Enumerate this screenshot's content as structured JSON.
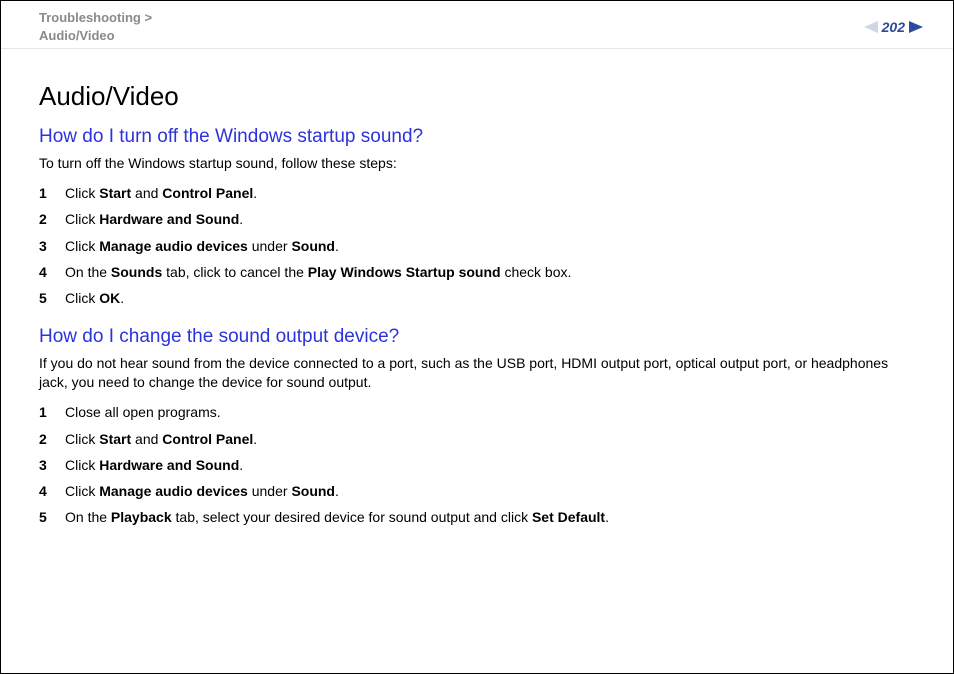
{
  "breadcrumb": {
    "parent": "Troubleshooting",
    "sep": ">",
    "current": "Audio/Video"
  },
  "page_number": "202",
  "h1": "Audio/Video",
  "section1": {
    "heading": "How do I turn off the Windows startup sound?",
    "intro": "To turn off the Windows startup sound, follow these steps:",
    "steps": [
      {
        "n": "1",
        "html": "Click <b>Start</b> and <b>Control Panel</b>."
      },
      {
        "n": "2",
        "html": "Click <b>Hardware and Sound</b>."
      },
      {
        "n": "3",
        "html": "Click <b>Manage audio devices</b> under <b>Sound</b>."
      },
      {
        "n": "4",
        "html": "On the <b>Sounds</b> tab, click to cancel the <b>Play Windows Startup sound</b> check box."
      },
      {
        "n": "5",
        "html": "Click <b>OK</b>."
      }
    ]
  },
  "section2": {
    "heading": "How do I change the sound output device?",
    "intro": "If you do not hear sound from the device connected to a port, such as the USB port, HDMI output port, optical output port, or headphones jack, you need to change the device for sound output.",
    "steps": [
      {
        "n": "1",
        "html": "Close all open programs."
      },
      {
        "n": "2",
        "html": "Click <b>Start</b> and <b>Control Panel</b>."
      },
      {
        "n": "3",
        "html": "Click <b>Hardware and Sound</b>."
      },
      {
        "n": "4",
        "html": "Click <b>Manage audio devices</b> under <b>Sound</b>."
      },
      {
        "n": "5",
        "html": "On the <b>Playback</b> tab, select your desired device for sound output and click <b>Set Default</b>."
      }
    ]
  }
}
